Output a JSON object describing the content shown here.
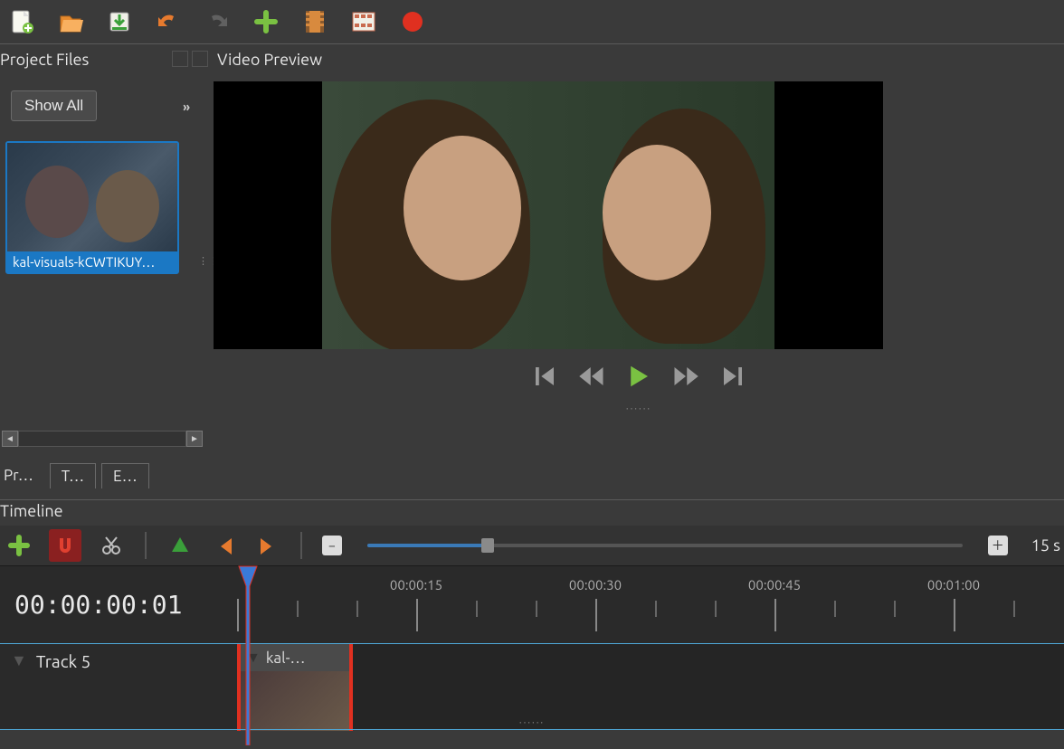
{
  "panels": {
    "project_files": "Project Files",
    "video_preview": "Video Preview",
    "timeline": "Timeline"
  },
  "project": {
    "show_all": "Show All",
    "file_label": "kal-visuals-kCWTIKUY…"
  },
  "bottom_tabs": {
    "project": "Pr…",
    "transitions": "T…",
    "effects": "E…"
  },
  "timeline": {
    "zoom_label": "15 s",
    "current_time": "00:00:00:01",
    "ruler": [
      "00:00:15",
      "00:00:30",
      "00:00:45",
      "00:01:00"
    ],
    "track_name": "Track 5",
    "clip_label": "kal-…"
  }
}
